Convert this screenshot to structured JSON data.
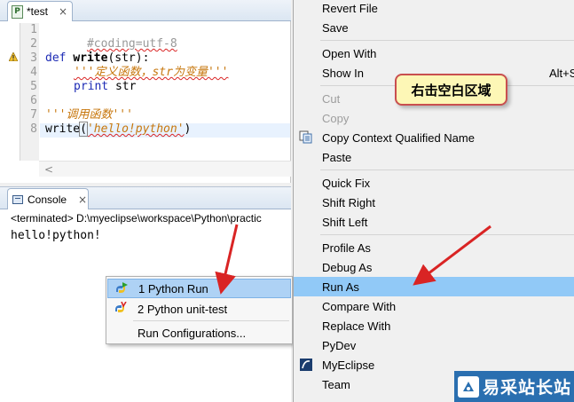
{
  "editor": {
    "tab_label": "*test",
    "file_icon_glyph": "P",
    "close_glyph": "×",
    "line_numbers": [
      "1",
      "2",
      "3",
      "4",
      "5",
      "6",
      "7",
      "8"
    ],
    "lines": {
      "l1": "#coding=utf-8",
      "l3_kw": "def",
      "l3_fn": "write",
      "l3_rest": "(str):",
      "l4_doc": "'''定义函数，str为变量'''",
      "l5_kw": "print",
      "l5_rest": " str",
      "l7_doc": "'''调用函数'''",
      "l8_fn": "write",
      "l8_open": "(",
      "l8_str": "'hello!python'",
      "l8_close": ")"
    },
    "scroll_left_glyph": "<"
  },
  "console": {
    "tab_label": "Console",
    "close_glyph": "×",
    "terminated": "<terminated> D:\\myeclipse\\workspace\\Python\\practic",
    "output": "hello!python!"
  },
  "submenu": {
    "items": [
      {
        "label": "1 Python Run"
      },
      {
        "label": "2 Python unit-test"
      },
      {
        "label": "Run Configurations..."
      }
    ]
  },
  "context_menu": {
    "items": [
      {
        "label": "Revert File"
      },
      {
        "label": "Save"
      },
      {
        "label": "Open With"
      },
      {
        "label": "Show In",
        "accel": "Alt+S"
      },
      {
        "label": "Cut"
      },
      {
        "label": "Copy"
      },
      {
        "label": "Copy Context Qualified Name"
      },
      {
        "label": "Paste"
      },
      {
        "label": "Quick Fix"
      },
      {
        "label": "Shift Right"
      },
      {
        "label": "Shift Left"
      },
      {
        "label": "Profile As"
      },
      {
        "label": "Debug As"
      },
      {
        "label": "Run As"
      },
      {
        "label": "Compare With"
      },
      {
        "label": "Replace With"
      },
      {
        "label": "PyDev"
      },
      {
        "label": "MyEclipse"
      },
      {
        "label": "Team"
      }
    ]
  },
  "callout": {
    "text": "右击空白区域"
  },
  "watermark": {
    "text": "易采站长站"
  },
  "colors": {
    "selection": "#91c9f7",
    "annotation_red": "#d92424",
    "callout_fill": "#fdf7b6"
  }
}
